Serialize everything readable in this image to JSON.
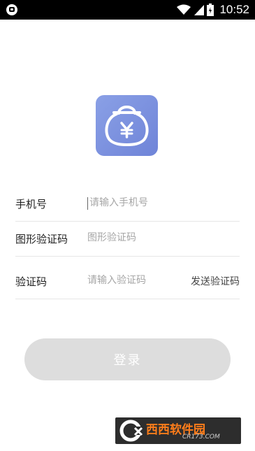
{
  "status_bar": {
    "time": "10:52",
    "icons": [
      "app-notification-icon",
      "wifi-icon",
      "signal-icon",
      "battery-icon"
    ]
  },
  "app": {
    "logo_icon": "money-bag-yen-icon",
    "logo_gradient": [
      "#8aa0e6",
      "#6f84d8"
    ]
  },
  "form": {
    "phone": {
      "label": "手机号",
      "placeholder": "请输入手机号"
    },
    "captcha": {
      "label": "图形验证码",
      "placeholder": "图形验证码"
    },
    "sms_code": {
      "label": "验证码",
      "placeholder": "请输入验证码",
      "send_label": "发送验证码"
    }
  },
  "login_button": {
    "label": "登录",
    "background": "#dddddd"
  },
  "watermark": {
    "text": "西西软件园",
    "sub": "CR173.COM"
  }
}
